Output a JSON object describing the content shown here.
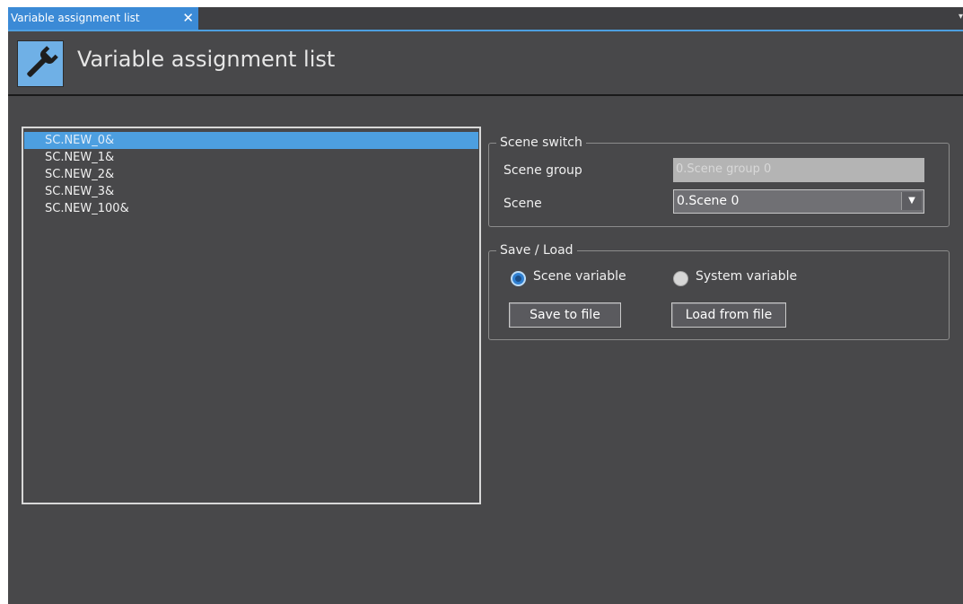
{
  "tab": {
    "title": "Variable assignment list",
    "close_icon": "✕",
    "menu_icon": "▾"
  },
  "header": {
    "icon_name": "wrench-icon",
    "title": "Variable assignment list"
  },
  "variable_list": {
    "items": [
      {
        "label": "SC.NEW_0&",
        "selected": true
      },
      {
        "label": "SC.NEW_1&",
        "selected": false
      },
      {
        "label": "SC.NEW_2&",
        "selected": false
      },
      {
        "label": "SC.NEW_3&",
        "selected": false
      },
      {
        "label": "SC.NEW_100&",
        "selected": false
      }
    ]
  },
  "scene_switch": {
    "title": "Scene switch",
    "scene_group_label": "Scene group",
    "scene_group_value": "0.Scene group 0",
    "scene_label": "Scene",
    "scene_value": "0.Scene 0",
    "dropdown_icon": "▼"
  },
  "save_load": {
    "title": "Save / Load",
    "radio_scene": {
      "label": "Scene variable",
      "checked": true
    },
    "radio_system": {
      "label": "System variable",
      "checked": false
    },
    "save_button": "Save to file",
    "load_button": "Load from file"
  },
  "colors": {
    "accent": "#4d9fe0",
    "background": "#48484a",
    "tab": "#3b8ad6"
  }
}
